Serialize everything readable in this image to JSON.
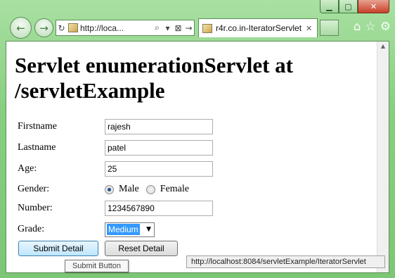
{
  "window": {
    "caption_minimize": "▁",
    "caption_maximize": "▢",
    "caption_close": "✕"
  },
  "nav": {
    "back_glyph": "←",
    "forward_glyph": "→",
    "address_refresh_glyph": "↻",
    "address_url": "http://loca...",
    "address_search_glyph": "⌕",
    "address_dropdown_glyph": "▾",
    "address_compat_glyph": "⊠",
    "address_go_glyph": "→"
  },
  "tab": {
    "title": "r4r.co.in-IteratorServlet",
    "close_glyph": "✕"
  },
  "toolbar": {
    "home_glyph": "⌂",
    "favorites_glyph": "☆",
    "tools_glyph": "⚙"
  },
  "page": {
    "heading": "Servlet enumerationServlet at /servletExample"
  },
  "form": {
    "firstname_label": "Firstname",
    "firstname_value": "rajesh",
    "lastname_label": "Lastname",
    "lastname_value": "patel",
    "age_label": "Age:",
    "age_value": "25",
    "gender_label": "Gender:",
    "gender_male": "Male",
    "gender_female": "Female",
    "gender_selected": "Male",
    "number_label": "Number:",
    "number_value": "1234567890",
    "grade_label": "Grade:",
    "grade_value": "Medium",
    "submit_label": "Submit Detail",
    "reset_label": "Reset Detail"
  },
  "tooltip": {
    "text": "Submit Button"
  },
  "status": {
    "text": "http://localhost:8084/servletExample/IteratorServlet"
  },
  "scrollbar": {
    "up_glyph": "▲"
  }
}
